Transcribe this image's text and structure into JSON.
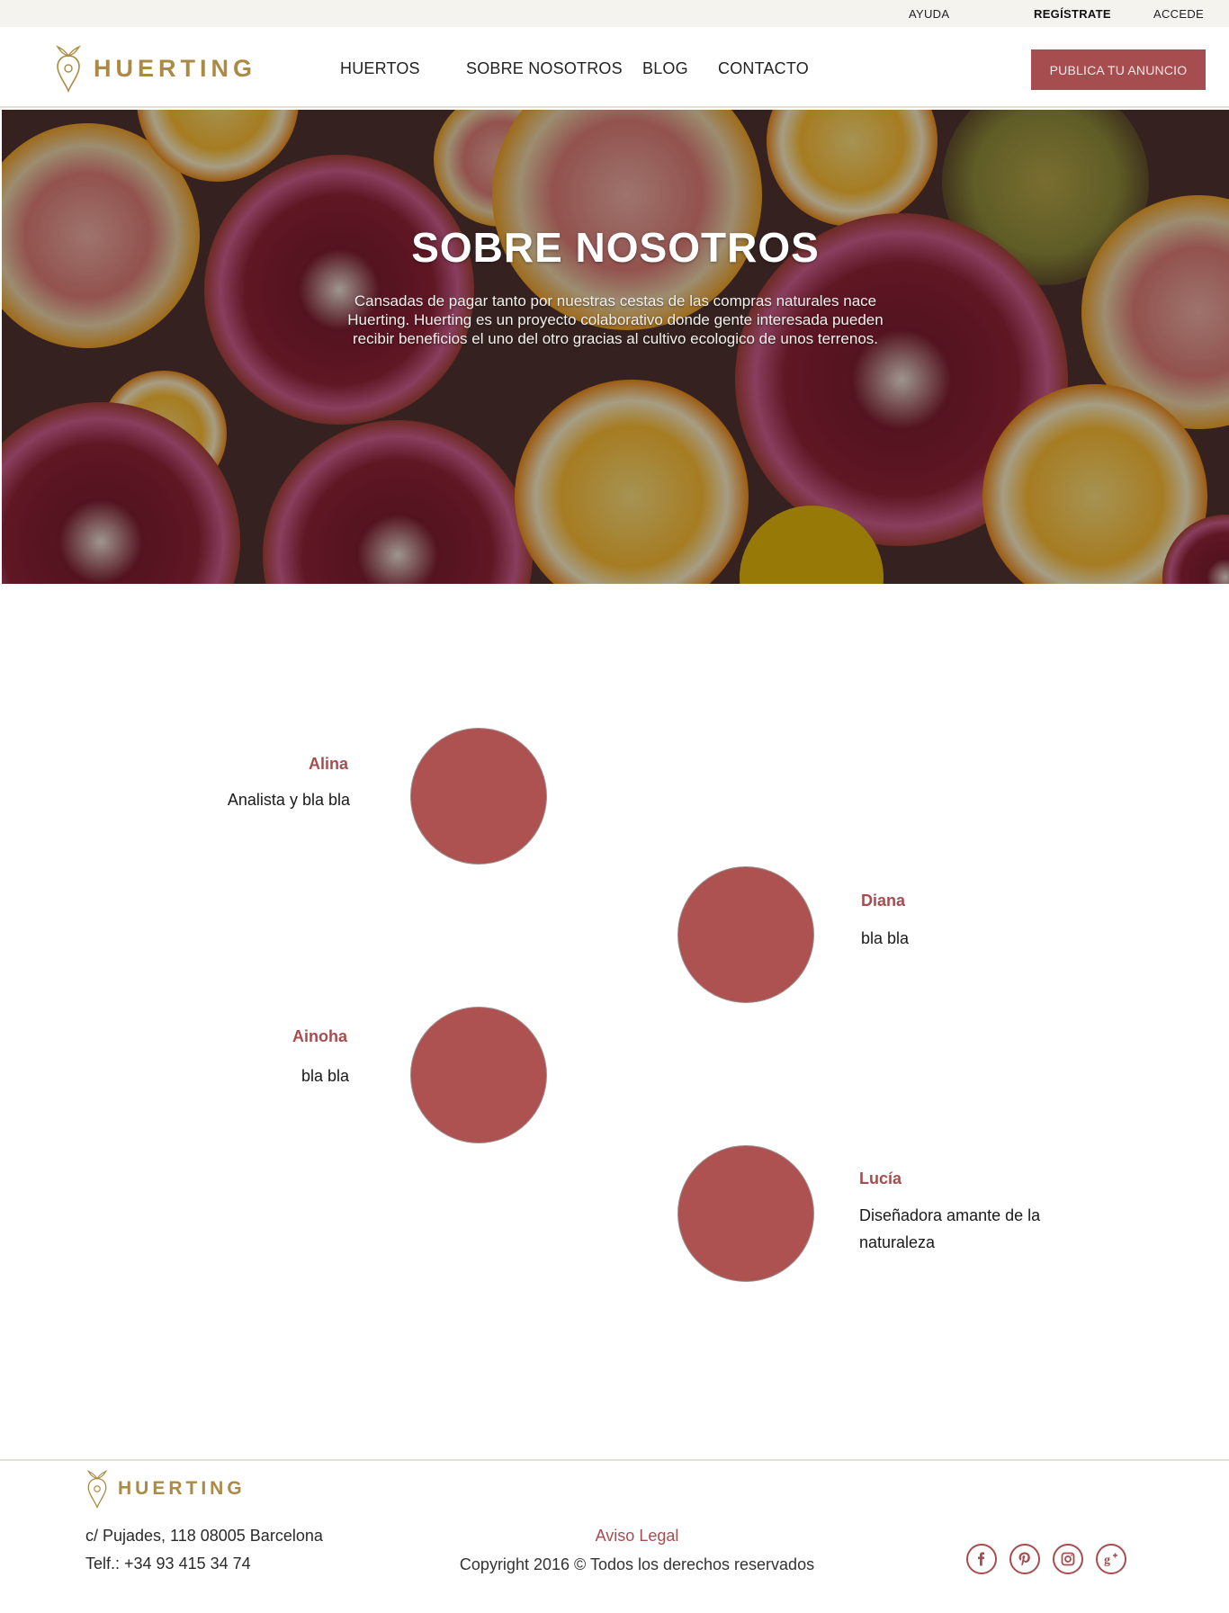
{
  "topbar": {
    "help": "AYUDA",
    "register": "REGÍSTRATE",
    "login": "ACCEDE"
  },
  "brand": {
    "name": "HUERTING",
    "color": "#ab8a45"
  },
  "nav": {
    "items": [
      "HUERTOS",
      "SOBRE NOSOTROS",
      "BLOG",
      "CONTACTO"
    ]
  },
  "header": {
    "cta": "PUBLICA TU ANUNCIO"
  },
  "hero": {
    "title": "SOBRE NOSOTROS",
    "text": "Cansadas de pagar tanto por nuestras cestas de las compras naturales nace Huerting. Huerting es un proyecto colaborativo  donde gente interesada pueden recibir beneficios el uno del otro gracias al cultivo ecologico de unos terrenos."
  },
  "team": [
    {
      "name": "Alina",
      "role": "Analista y bla bla"
    },
    {
      "name": "Diana",
      "role": "bla bla"
    },
    {
      "name": "Ainoha",
      "role": "bla bla"
    },
    {
      "name": "Lucía",
      "role": "Diseñadora amante de la naturaleza"
    }
  ],
  "footer": {
    "address": "c/ Pujades, 118 08005 Barcelona",
    "phone": "Telf.: +34 93 415 34 74",
    "legal": "Aviso Legal",
    "copyright": "Copyright 2016 © Todos los derechos reservados",
    "social": [
      "facebook-icon",
      "pinterest-icon",
      "instagram-icon",
      "google-plus-icon"
    ]
  },
  "colors": {
    "accent": "#a64d4f",
    "topbar_bg": "#f5f3ee",
    "circle": "#ad5250"
  }
}
